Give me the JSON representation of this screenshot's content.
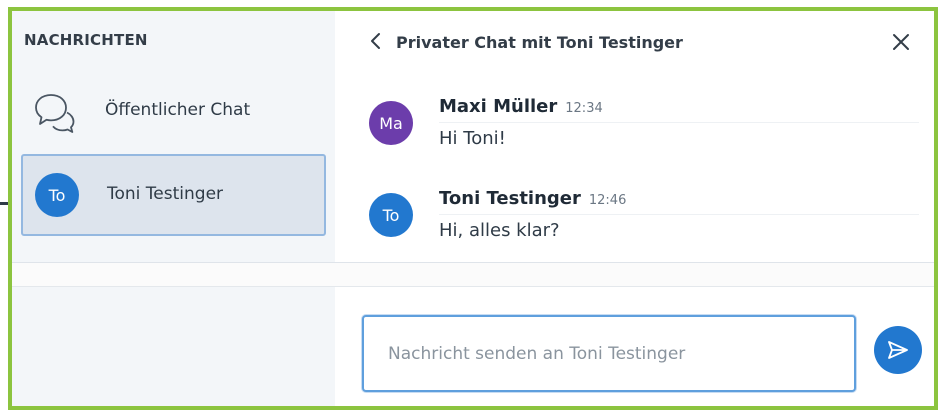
{
  "sidebar": {
    "title": "NACHRICHTEN",
    "items": [
      {
        "label": "Öffentlicher Chat",
        "icon": "chat-bubbles-icon"
      },
      {
        "label": "Toni Testinger",
        "avatar": "To",
        "active": true
      }
    ]
  },
  "header": {
    "back_icon": "chevron-left-icon",
    "title": "Privater Chat mit Toni Testinger",
    "close_icon": "close-icon"
  },
  "messages": [
    {
      "avatar": "Ma",
      "avatar_color": "#6c3dab",
      "name": "Maxi Müller",
      "time": "12:34",
      "text": "Hi Toni!"
    },
    {
      "avatar": "To",
      "avatar_color": "#2278cf",
      "name": "Toni Testinger",
      "time": "12:46",
      "text": "Hi, alles klar?"
    }
  ],
  "composer": {
    "placeholder": "Nachricht senden an Toni Testinger",
    "value": "",
    "send_icon": "send-icon"
  },
  "colors": {
    "frame": "#8cc43f",
    "accent": "#2278cf"
  }
}
